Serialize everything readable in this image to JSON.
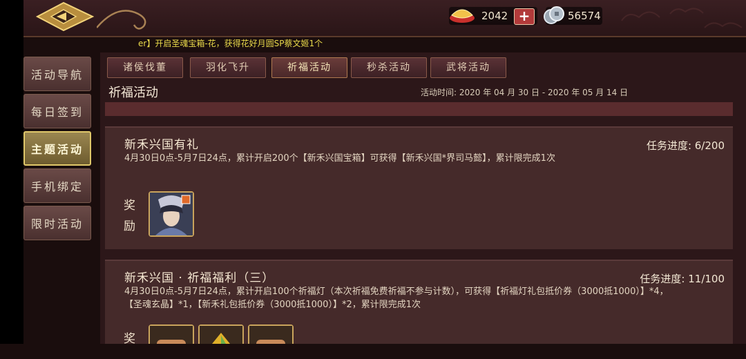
{
  "top": {
    "gold_value": "2042",
    "coin_value": "56574",
    "ticker": "er】开启圣魂宝箱-花，获得花好月圆SP蔡文姬1个"
  },
  "sidebar": {
    "items": [
      {
        "label": "活动导航"
      },
      {
        "label": "每日签到"
      },
      {
        "label": "主题活动"
      },
      {
        "label": "手机绑定"
      },
      {
        "label": "限时活动"
      }
    ],
    "active_index": 2
  },
  "tabs": [
    {
      "label": "诸侯伐董"
    },
    {
      "label": "羽化飞升"
    },
    {
      "label": "祈福活动"
    },
    {
      "label": "秒杀活动"
    },
    {
      "label": "武将活动"
    }
  ],
  "main": {
    "title": "祈福活动",
    "time": "活动时间: 2020 年 04 月 30 日  - 2020 年 05 月 14 日"
  },
  "cards": [
    {
      "title": "新禾兴国有礼",
      "progress": "任务进度: 6/200",
      "desc": "4月30日0点-5月7日24点，累计开启200个【新禾兴国宝箱】可获得【新禾兴国*界司马懿】，累计限完成1次",
      "reward_label": "奖励"
    },
    {
      "title": "新禾兴国 · 祈福福利（三）",
      "progress": "任务进度: 11/100",
      "desc": "4月30日0点-5月7日24点，累计开启100个祈福灯（本次祈福免费祈福不参与计数），可获得【祈福灯礼包抵价券（3000抵1000）】*4，【圣魂玄晶】*1，【新禾礼包抵价券（3000抵1000）】*2，累计限完成1次",
      "reward_label": "奖励"
    }
  ],
  "colors": {
    "accent_gold": "#e0c86a",
    "ticker": "#e8d84a",
    "card_bg": "#452a2a"
  }
}
